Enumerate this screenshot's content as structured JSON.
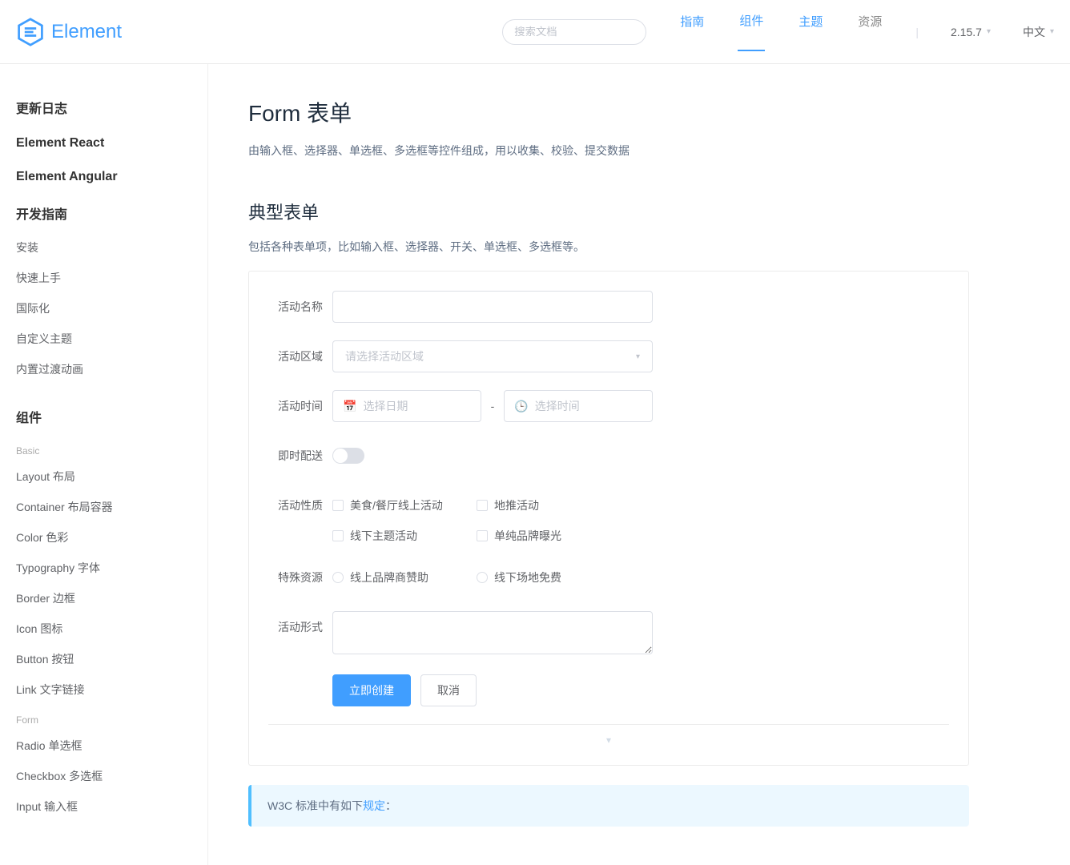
{
  "brand": "Element",
  "header": {
    "search_placeholder": "搜索文档",
    "nav": {
      "guide": "指南",
      "component": "组件",
      "theme": "主题",
      "resource": "资源"
    },
    "version": "2.15.7",
    "lang": "中文"
  },
  "sidebar": {
    "changelog": "更新日志",
    "react": "Element React",
    "angular": "Element Angular",
    "devguide": "开发指南",
    "devguide_items": {
      "install": "安装",
      "quickstart": "快速上手",
      "i18n": "国际化",
      "custom_theme": "自定义主题",
      "transition": "内置过渡动画"
    },
    "components_title": "组件",
    "basic_label": "Basic",
    "basic_items": {
      "layout": "Layout 布局",
      "container": "Container 布局容器",
      "color": "Color 色彩",
      "typography": "Typography 字体",
      "border": "Border 边框",
      "icon": "Icon 图标",
      "button": "Button 按钮",
      "link": "Link 文字链接"
    },
    "form_label": "Form",
    "form_items": {
      "radio": "Radio 单选框",
      "checkbox": "Checkbox 多选框",
      "input": "Input 输入框"
    }
  },
  "page": {
    "title": "Form 表单",
    "desc": "由输入框、选择器、单选框、多选框等控件组成，用以收集、校验、提交数据",
    "section_title": "典型表单",
    "section_desc": "包括各种表单项，比如输入框、选择器、开关、单选框、多选框等。"
  },
  "form": {
    "labels": {
      "name": "活动名称",
      "region": "活动区域",
      "time": "活动时间",
      "delivery": "即时配送",
      "type": "活动性质",
      "resource": "特殊资源",
      "desc": "活动形式"
    },
    "placeholders": {
      "region": "请选择活动区域",
      "date": "选择日期",
      "time": "选择时间"
    },
    "checkboxes": {
      "c1": "美食/餐厅线上活动",
      "c2": "地推活动",
      "c3": "线下主题活动",
      "c4": "单纯品牌曝光"
    },
    "radios": {
      "r1": "线上品牌商赞助",
      "r2": "线下场地免费"
    },
    "buttons": {
      "submit": "立即创建",
      "cancel": "取消"
    },
    "time_sep": "-"
  },
  "footer_arrow": "▾",
  "tip": {
    "prefix": "W3C 标准中有如下",
    "link": "规定",
    "suffix": "："
  }
}
